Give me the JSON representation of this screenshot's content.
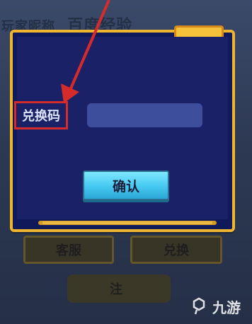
{
  "background": {
    "top_text_left": "玩家昵称",
    "top_text_right": "百度经验"
  },
  "dialog": {
    "field_label": "兑换码",
    "field_value": "",
    "confirm_label": "确认"
  },
  "buttons": {
    "customer_service": "客服",
    "redeem": "兑换",
    "bottom_partial": "注"
  },
  "watermark": {
    "text": "九游"
  },
  "colors": {
    "dialog_border": "#f0b52e",
    "dialog_bg": "#1a2166",
    "input_bg": "#3c4e9c",
    "confirm_bg": "#45c8f0",
    "highlight_red": "#d62b2b"
  }
}
